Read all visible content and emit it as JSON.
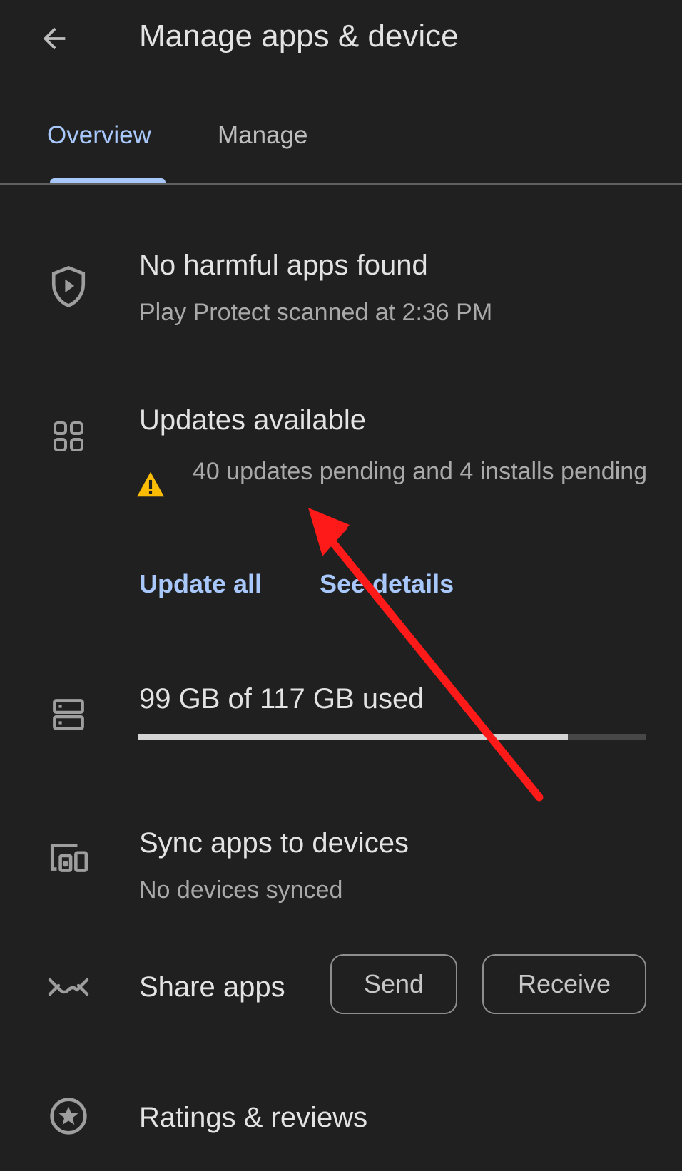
{
  "header": {
    "title": "Manage apps & device",
    "back_icon": "arrow-back-icon"
  },
  "tabs": [
    {
      "label": "Overview",
      "active": true
    },
    {
      "label": "Manage",
      "active": false
    }
  ],
  "protect": {
    "icon": "shield-play-icon",
    "title": "No harmful apps found",
    "subtitle": "Play Protect scanned at 2:36 PM"
  },
  "updates": {
    "icon": "apps-grid-icon",
    "title": "Updates available",
    "warning_icon": "warning-icon",
    "description": "40 updates pending and 4 installs pending",
    "update_all_label": "Update all",
    "see_details_label": "See details"
  },
  "storage": {
    "icon": "storage-icon",
    "label": "99 GB of 117 GB used",
    "used_gb": 99,
    "total_gb": 117
  },
  "sync": {
    "icon": "devices-icon",
    "title": "Sync apps to devices",
    "subtitle": "No devices synced"
  },
  "share": {
    "icon": "nearby-share-icon",
    "title": "Share apps",
    "send_label": "Send",
    "receive_label": "Receive"
  },
  "ratings": {
    "icon": "star-circle-icon",
    "title": "Ratings & reviews"
  },
  "colors": {
    "background": "#202020",
    "accent": "#a8c7fa",
    "warning": "#fbbc04",
    "annotation_arrow": "#ff1a1a"
  }
}
